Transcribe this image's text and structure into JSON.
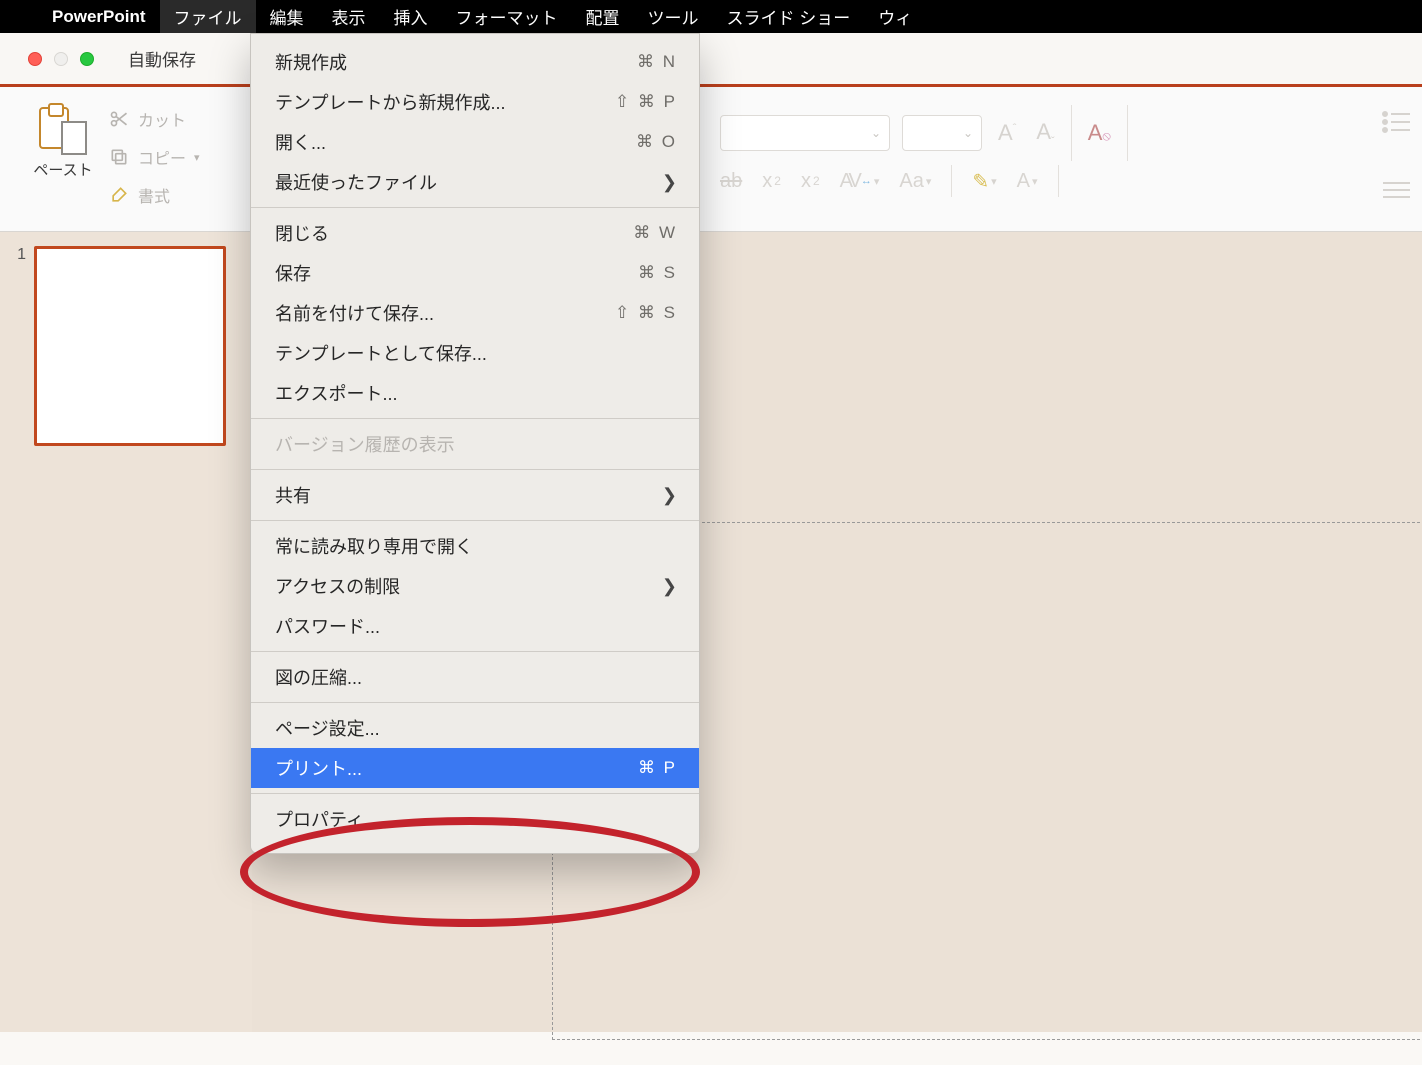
{
  "menubar": {
    "appname": "PowerPoint",
    "items": [
      "ファイル",
      "編集",
      "表示",
      "挿入",
      "フォーマット",
      "配置",
      "ツール",
      "スライド ショー",
      "ウィ"
    ],
    "active_index": 0
  },
  "titlebar": {
    "autosave_label": "自動保存"
  },
  "ribbon": {
    "paste_label": "ペースト",
    "cut_label": "カット",
    "copy_label": "コピー",
    "format_label": "書式"
  },
  "font_tools": {
    "increase": "A",
    "decrease": "A",
    "strike": "ab",
    "super": "x",
    "sub": "x",
    "kerning": "AV",
    "case": "Aa",
    "textA": "A"
  },
  "thumbnail": {
    "number": "1"
  },
  "file_menu": [
    {
      "type": "item",
      "label": "新規作成",
      "shortcut": "⌘ N"
    },
    {
      "type": "item",
      "label": "テンプレートから新規作成...",
      "shortcut": "⇧ ⌘ P"
    },
    {
      "type": "item",
      "label": "開く...",
      "shortcut": "⌘ O"
    },
    {
      "type": "item",
      "label": "最近使ったファイル",
      "submenu": true
    },
    {
      "type": "divider"
    },
    {
      "type": "item",
      "label": "閉じる",
      "shortcut": "⌘ W"
    },
    {
      "type": "item",
      "label": "保存",
      "shortcut": "⌘ S"
    },
    {
      "type": "item",
      "label": "名前を付けて保存...",
      "shortcut": "⇧ ⌘ S"
    },
    {
      "type": "item",
      "label": "テンプレートとして保存..."
    },
    {
      "type": "item",
      "label": "エクスポート..."
    },
    {
      "type": "divider"
    },
    {
      "type": "item",
      "label": "バージョン履歴の表示",
      "disabled": true
    },
    {
      "type": "divider"
    },
    {
      "type": "item",
      "label": "共有",
      "submenu": true
    },
    {
      "type": "divider"
    },
    {
      "type": "item",
      "label": "常に読み取り専用で開く"
    },
    {
      "type": "item",
      "label": "アクセスの制限",
      "submenu": true
    },
    {
      "type": "item",
      "label": "パスワード..."
    },
    {
      "type": "divider"
    },
    {
      "type": "item",
      "label": "図の圧縮..."
    },
    {
      "type": "divider"
    },
    {
      "type": "item",
      "label": "ページ設定..."
    },
    {
      "type": "item",
      "label": "プリント...",
      "shortcut": "⌘ P",
      "highlight": true
    },
    {
      "type": "divider"
    },
    {
      "type": "item",
      "label": "プロパティ"
    }
  ]
}
